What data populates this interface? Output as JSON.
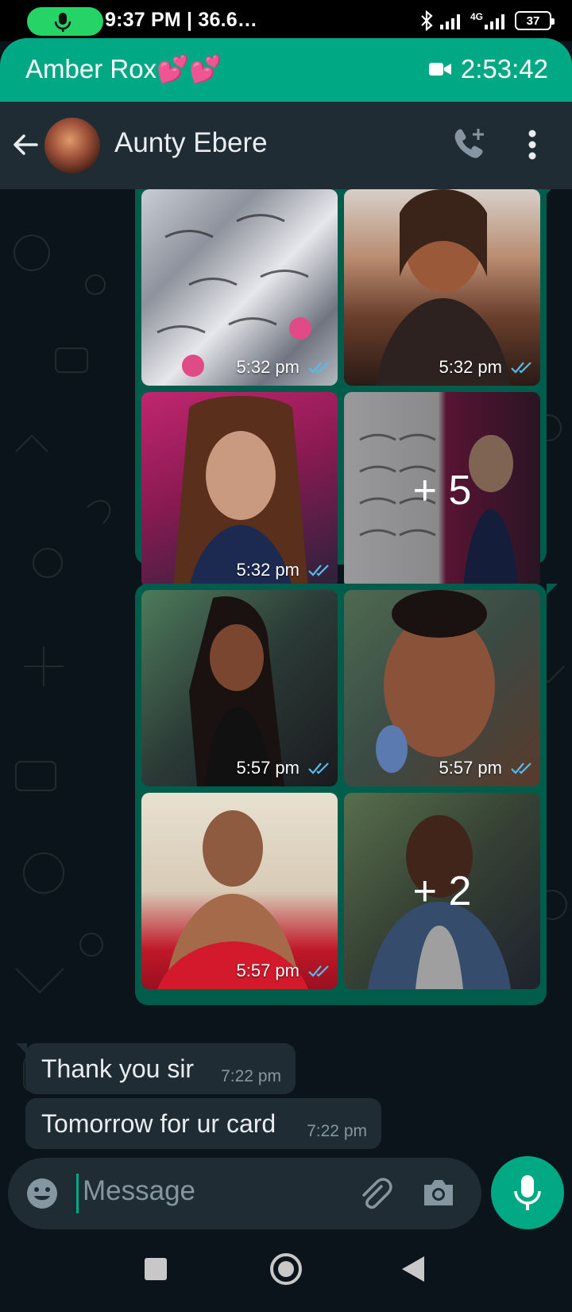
{
  "status_bar": {
    "time_info": "9:37 PM | 36.6…",
    "network": "4G",
    "battery": "37"
  },
  "call_banner": {
    "name": "Amber Rox💕💕",
    "duration": "2:53:42"
  },
  "header": {
    "contact_name": "Aunty Ebere"
  },
  "media_groups": [
    {
      "tiles": [
        {
          "time": "5:32 pm",
          "overlay": ""
        },
        {
          "time": "5:32 pm",
          "overlay": ""
        },
        {
          "time": "5:32 pm",
          "overlay": ""
        },
        {
          "time": "",
          "overlay": "+ 5"
        }
      ]
    },
    {
      "tiles": [
        {
          "time": "5:57 pm",
          "overlay": ""
        },
        {
          "time": "5:57 pm",
          "overlay": ""
        },
        {
          "time": "5:57 pm",
          "overlay": ""
        },
        {
          "time": "",
          "overlay": "+ 2"
        }
      ]
    }
  ],
  "messages": [
    {
      "text": "Thank you sir",
      "time": "7:22 pm"
    },
    {
      "text": "Tomorrow for ur card",
      "time": "7:22 pm"
    }
  ],
  "composer": {
    "placeholder": "Message"
  },
  "colors": {
    "accent": "#00a884",
    "outgoing_bubble": "#005c4b",
    "incoming_bubble": "#1f2c34",
    "read_ticks": "#53bdeb"
  }
}
